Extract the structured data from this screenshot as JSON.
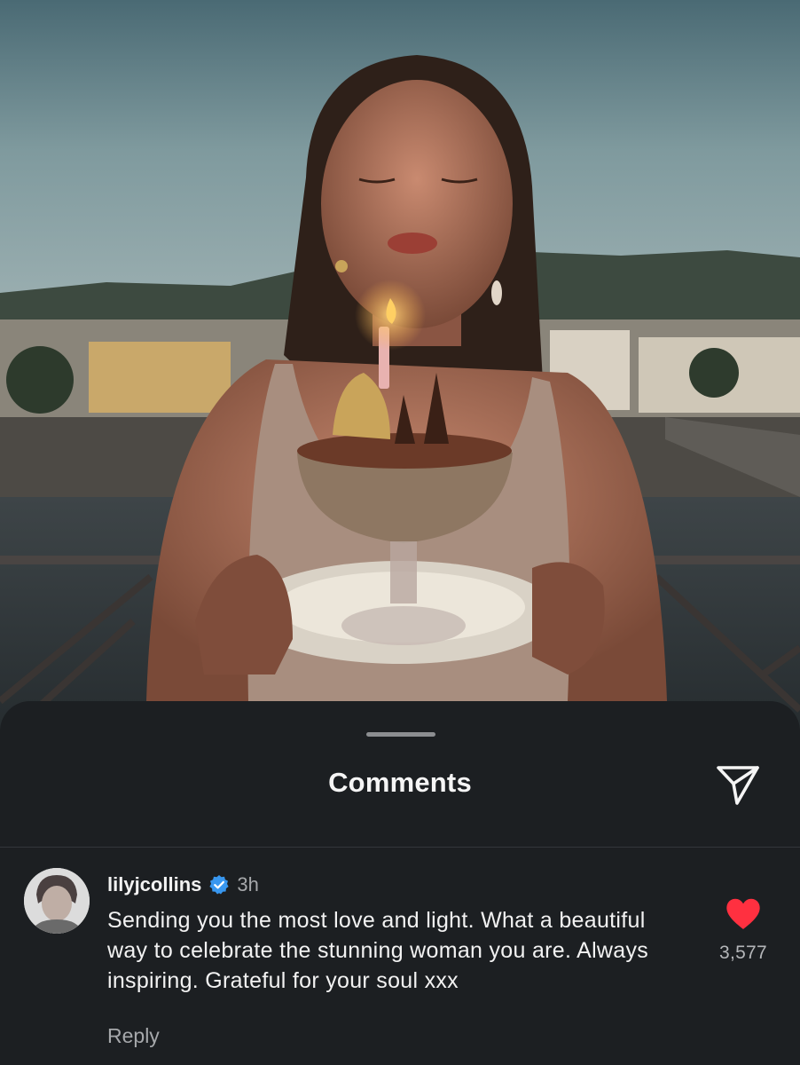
{
  "photo": {
    "icon": "post-photo-birthday-cake"
  },
  "sheet": {
    "title": "Comments",
    "share_icon": "paper-plane-icon"
  },
  "comment": {
    "username": "lilyjcollins",
    "verified_icon": "verified-badge-icon",
    "time": "3h",
    "text": "Sending you the most love and light. What a beautiful way to celebrate the stunning woman you are. Always inspiring. Grateful for your soul xxx",
    "reply_label": "Reply",
    "like_icon": "heart-icon",
    "like_count": "3,577"
  },
  "colors": {
    "sheet_background": "#1c1f22",
    "like_red": "#ff3040",
    "verified_blue": "#3897f0",
    "secondary_text": "#a6a8ab"
  }
}
